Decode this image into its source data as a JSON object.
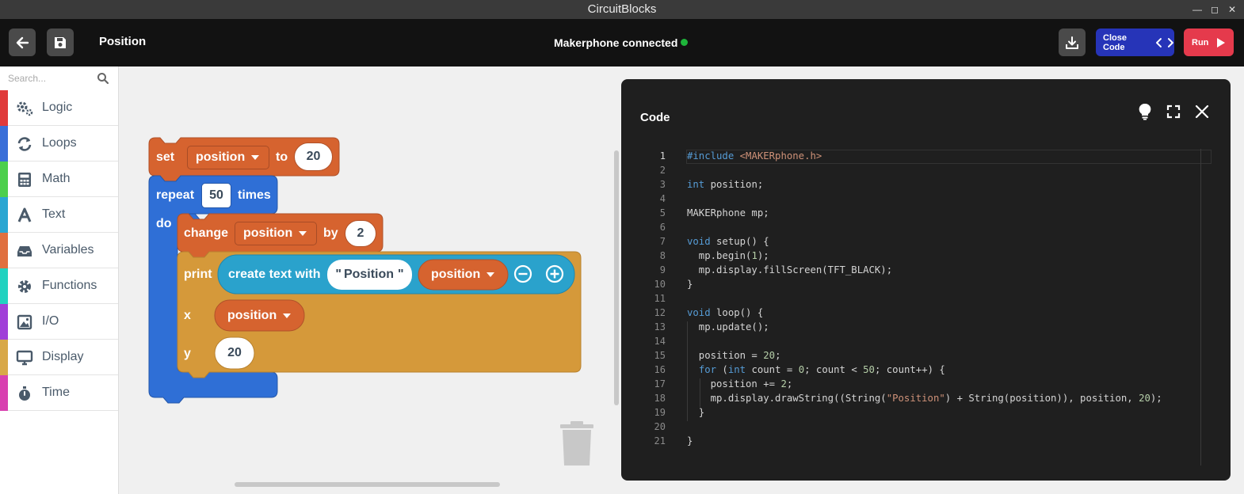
{
  "window": {
    "title": "CircuitBlocks"
  },
  "header": {
    "project_title": "Position",
    "connection_status": "Makerphone connected",
    "close_code_label": "Close Code",
    "run_label": "Run"
  },
  "toolbox": {
    "search_placeholder": "Search...",
    "categories": [
      {
        "label": "Logic",
        "color": "#e03a3a",
        "icon": "gears-icon"
      },
      {
        "label": "Loops",
        "color": "#3a6fd8",
        "icon": "loop-arrows-icon"
      },
      {
        "label": "Math",
        "color": "#4ccf4c",
        "icon": "calculator-icon"
      },
      {
        "label": "Text",
        "color": "#2aa6d2",
        "icon": "text-a-icon"
      },
      {
        "label": "Variables",
        "color": "#e07040",
        "icon": "inbox-icon"
      },
      {
        "label": "Functions",
        "color": "#21d2c0",
        "icon": "gear-icon"
      },
      {
        "label": "I/O",
        "color": "#a040d8",
        "icon": "image-icon"
      },
      {
        "label": "Display",
        "color": "#d8a848",
        "icon": "monitor-icon"
      },
      {
        "label": "Time",
        "color": "#d840b0",
        "icon": "stopwatch-icon"
      }
    ]
  },
  "blocks": {
    "set": {
      "kw": "set",
      "var": "position",
      "to": "to",
      "value": "20"
    },
    "repeat": {
      "kw": "repeat",
      "count": "50",
      "times": "times",
      "do": "do"
    },
    "change": {
      "kw": "change",
      "var": "position",
      "by": "by",
      "value": "2"
    },
    "print": {
      "kw": "print",
      "create_text": "create text with",
      "text_value": "Position",
      "var": "position",
      "x_label": "x",
      "x_var": "position",
      "y_label": "y",
      "y_value": "20"
    }
  },
  "code_panel": {
    "title": "Code",
    "lines": [
      "#include <MAKERphone.h>",
      "",
      "int position;",
      "",
      "MAKERphone mp;",
      "",
      "void setup() {",
      "  mp.begin(1);",
      "  mp.display.fillScreen(TFT_BLACK);",
      "}",
      "",
      "void loop() {",
      "  mp.update();",
      "",
      "  position = 20;",
      "  for (int count = 0; count < 50; count++) {",
      "    position += 2;",
      "    mp.display.drawString((String(\"Position\") + String(position)), position, 20);",
      "  }",
      "",
      "}"
    ]
  }
}
